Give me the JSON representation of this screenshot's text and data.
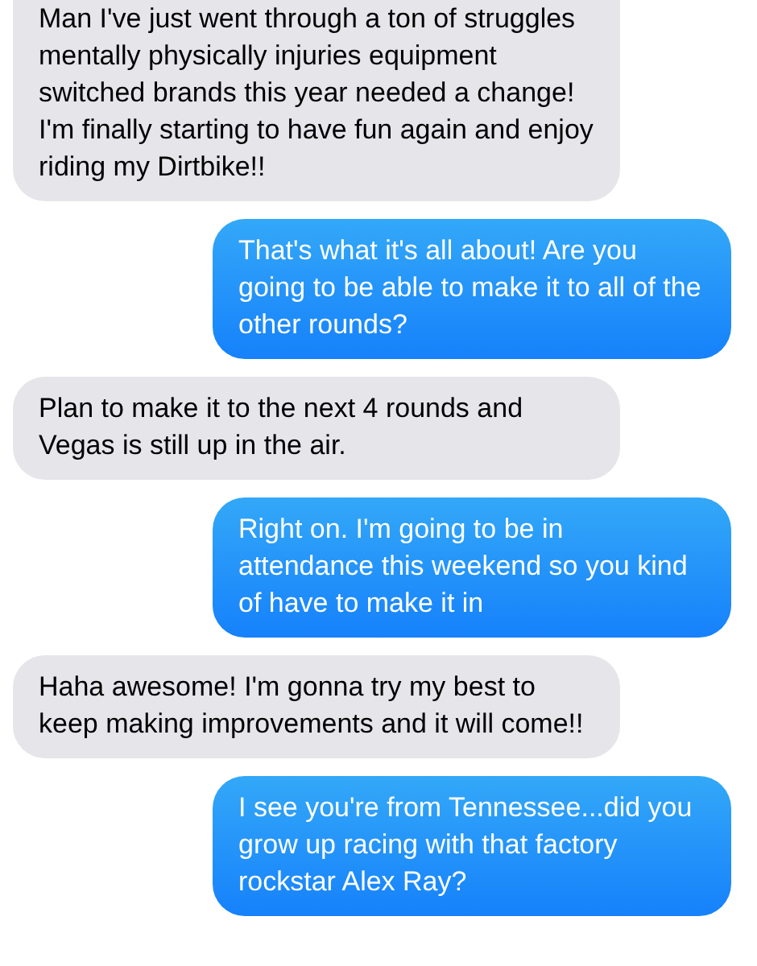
{
  "messages": [
    {
      "kind": "incoming",
      "text": "Man I've just went through a ton of struggles mentally physically injuries equipment switched brands this year needed a change! I'm finally starting to have fun again and enjoy riding my Dirtbike!!"
    },
    {
      "kind": "outgoing",
      "text": "That's what it's all about! Are you going to be able to make it to all of the other rounds?"
    },
    {
      "kind": "incoming",
      "text": "Plan to make it to the next 4 rounds and Vegas is still up in the air."
    },
    {
      "kind": "outgoing",
      "text": "Right on. I'm going to be in attendance this weekend so you kind of have to make it in"
    },
    {
      "kind": "incoming",
      "text": "Haha awesome! I'm gonna try my best to keep making improvements and it will come!!"
    },
    {
      "kind": "outgoing",
      "text": "I see you're from Tennessee...did you grow up racing with that factory rockstar Alex Ray?"
    }
  ]
}
